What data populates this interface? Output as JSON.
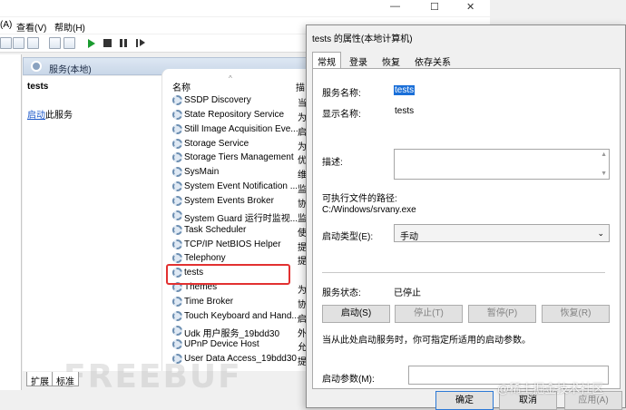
{
  "menu": {
    "items": [
      "(A)",
      "查看(V)",
      "帮助(H)"
    ]
  },
  "window_controls": {
    "minimize": "—",
    "maximize": "☐",
    "close": "✕"
  },
  "panel_header": {
    "title": "服务(本地)"
  },
  "left_pane": {
    "service_name": "tests",
    "start_link": "启动",
    "start_suffix": "此服务"
  },
  "list": {
    "column_name": "名称",
    "column_desc": "描",
    "rows": [
      {
        "name": "SSDP Discovery",
        "desc": "当"
      },
      {
        "name": "State Repository Service",
        "desc": "为"
      },
      {
        "name": "Still Image Acquisition Eve...",
        "desc": "启"
      },
      {
        "name": "Storage Service",
        "desc": "为"
      },
      {
        "name": "Storage Tiers Management",
        "desc": "优"
      },
      {
        "name": "SysMain",
        "desc": "维"
      },
      {
        "name": "System Event Notification ...",
        "desc": "监"
      },
      {
        "name": "System Events Broker",
        "desc": "协"
      },
      {
        "name": "System Guard 运行时监视...",
        "desc": "监"
      },
      {
        "name": "Task Scheduler",
        "desc": "使"
      },
      {
        "name": "TCP/IP NetBIOS Helper",
        "desc": "提"
      },
      {
        "name": "Telephony",
        "desc": "提"
      },
      {
        "name": "tests",
        "desc": ""
      },
      {
        "name": "Themes",
        "desc": "为"
      },
      {
        "name": "Time Broker",
        "desc": "协"
      },
      {
        "name": "Touch Keyboard and Hand...",
        "desc": "启"
      },
      {
        "name": "Udk 用户服务_19bdd30",
        "desc": "外"
      },
      {
        "name": "UPnP Device Host",
        "desc": "允"
      },
      {
        "name": "User Data Access_19bdd30",
        "desc": "提"
      }
    ]
  },
  "bottom_tabs": [
    "扩展",
    "标准"
  ],
  "dialog": {
    "title": "tests 的属性(本地计算机)",
    "tabs": [
      "常规",
      "登录",
      "恢复",
      "依存关系"
    ],
    "service_name_label": "服务名称:",
    "service_name_value": "tests",
    "display_name_label": "显示名称:",
    "display_name_value": "tests",
    "description_label": "描述:",
    "exe_path_label": "可执行文件的路径:",
    "exe_path_value": "C:/Windows/srvany.exe",
    "startup_type_label": "启动类型(E):",
    "startup_type_value": "手动",
    "status_label": "服务状态:",
    "status_value": "已停止",
    "buttons": {
      "start": "启动(S)",
      "stop": "停止(T)",
      "pause": "暂停(P)",
      "resume": "恢复(R)"
    },
    "hint": "当从此处启动服务时，你可指定所适用的启动参数。",
    "params_label": "启动参数(M):",
    "footer": {
      "ok": "确定",
      "cancel": "取消",
      "apply": "应用(A)"
    }
  },
  "watermarks": {
    "freebuf": "FREEBUF",
    "juejin": "@稀土掘金技术社区"
  }
}
